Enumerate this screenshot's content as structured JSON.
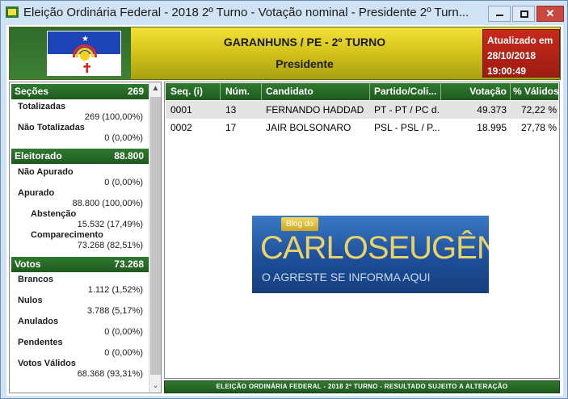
{
  "window": {
    "title": "Eleição Ordinária Federal - 2018 2º Turno - Votação nominal - Presidente 2º Turn...",
    "controls": {
      "minimize": "–",
      "maximize": "□",
      "close": "✕"
    }
  },
  "header": {
    "city": "GARANHUNS / PE - 2º TURNO",
    "office": "Presidente",
    "flag_icon": "pernambuco-flag-icon",
    "updated": {
      "label": "Atualizado em",
      "date": "28/10/2018",
      "time": "19:00:49"
    }
  },
  "summary": {
    "secoes": {
      "label": "Seções",
      "value": "269",
      "rows": [
        {
          "label": "Totalizadas",
          "value": "269 (100,00%)"
        },
        {
          "label": "Não Totalizadas",
          "value": "0 (0,00%)"
        }
      ]
    },
    "eleitorado": {
      "label": "Eleitorado",
      "value": "88.800",
      "rows": [
        {
          "label": "Não Apurado",
          "value": "0 (0,00%)"
        },
        {
          "label": "Apurado",
          "value": "88.800 (100,00%)"
        },
        {
          "label": "Abstenção",
          "value": "15.532 (17,49%)"
        },
        {
          "label": "Comparecimento",
          "value": "73.268 (82,51%)"
        }
      ]
    },
    "votos": {
      "label": "Votos",
      "value": "73.268",
      "rows": [
        {
          "label": "Brancos",
          "value": "1.112 (1,52%)"
        },
        {
          "label": "Nulos",
          "value": "3.788 (5,17%)"
        },
        {
          "label": "Anulados",
          "value": "0 (0,00%)"
        },
        {
          "label": "Pendentes",
          "value": "0 (0,00%)"
        },
        {
          "label": "Votos Válidos",
          "value": "68.368 (93,31%)"
        }
      ]
    }
  },
  "table": {
    "columns": [
      "Seq. (i)",
      "Núm.",
      "Candidato",
      "Partido/Coli...",
      "Votação",
      "% Válidos"
    ],
    "rows": [
      {
        "seq": "0001",
        "num": "13",
        "candidato": "FERNANDO HADDAD",
        "partido": "PT - PT / PC d...",
        "votacao": "49.373",
        "validos": "72,22 %"
      },
      {
        "seq": "0002",
        "num": "17",
        "candidato": "JAIR BOLSONARO",
        "partido": "PSL - PSL / P...",
        "votacao": "18.995",
        "validos": "27,78 %"
      }
    ]
  },
  "footer": "ELEIÇÃO ORDINÁRIA FEDERAL - 2018 2º TURNO - RESULTADO SUJEITO A ALTERAÇÃO",
  "watermark": {
    "tag": "Blog do",
    "name": "CARLOSEUGÊNIO",
    "slogan": "O AGRESTE SE INFORMA AQUI"
  },
  "colors": {
    "header_green": "#1f5a1e",
    "header_yellow": "#d3c21a",
    "updated_red": "#c82a1c"
  }
}
